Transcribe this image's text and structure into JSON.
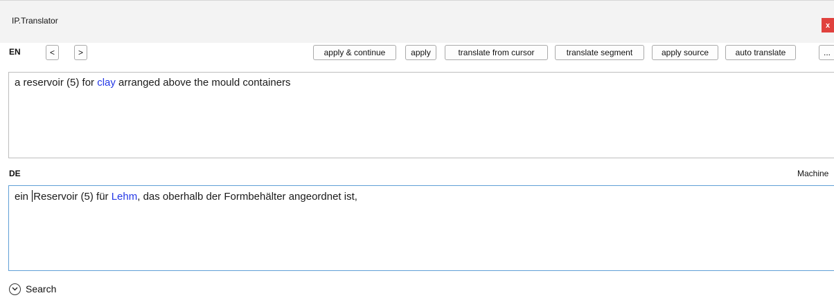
{
  "window": {
    "title": "IP.Translator",
    "close_label": "x"
  },
  "source": {
    "lang": "EN",
    "prev_label": "<",
    "next_label": ">",
    "toolbar": {
      "apply_continue": "apply & continue",
      "apply": "apply",
      "translate_from_cursor": "translate from cursor",
      "translate_segment": "translate segment",
      "apply_source": "apply source",
      "auto_translate": "auto translate",
      "more": "..."
    },
    "text": {
      "before": "a reservoir (5) for ",
      "term": "clay",
      "after": " arranged above the mould containers"
    }
  },
  "target": {
    "lang": "DE",
    "right_label": "Machine",
    "text": {
      "before": "ein ",
      "mid": "Reservoir (5) für ",
      "term": "Lehm",
      "after": ", das oberhalb der Formbehälter angeordnet ist,"
    }
  },
  "search": {
    "label": "Search"
  },
  "colors": {
    "term": "#2438e6",
    "close": "#e0413d",
    "focus_border": "#5f9fd6"
  }
}
